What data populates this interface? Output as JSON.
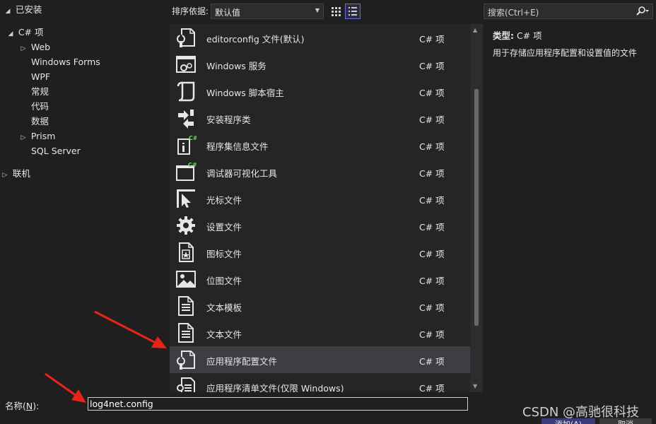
{
  "tree": {
    "installed": "已安装",
    "csharp": "C# 项",
    "children": [
      "Web",
      "Windows Forms",
      "WPF",
      "常规",
      "代码",
      "数据",
      "Prism",
      "SQL Server"
    ],
    "online": "联机"
  },
  "toolbar": {
    "sort_label": "排序依据:",
    "sort_value": "默认值",
    "search_placeholder": "搜索(Ctrl+E)"
  },
  "items": [
    {
      "name": "editorconfig 文件(默认)",
      "type": "C# 项",
      "icon": "config-file-icon"
    },
    {
      "name": "Windows 服务",
      "type": "C# 项",
      "icon": "windows-service-icon"
    },
    {
      "name": "Windows 脚本宿主",
      "type": "C# 项",
      "icon": "script-host-icon"
    },
    {
      "name": "安装程序类",
      "type": "C# 项",
      "icon": "installer-class-icon"
    },
    {
      "name": "程序集信息文件",
      "type": "C# 项",
      "icon": "assembly-info-icon"
    },
    {
      "name": "调试器可视化工具",
      "type": "C# 项",
      "icon": "debugger-visualizer-icon"
    },
    {
      "name": "光标文件",
      "type": "C# 项",
      "icon": "cursor-file-icon"
    },
    {
      "name": "设置文件",
      "type": "C# 项",
      "icon": "settings-gear-icon"
    },
    {
      "name": "图标文件",
      "type": "C# 项",
      "icon": "icon-file-icon"
    },
    {
      "name": "位图文件",
      "type": "C# 项",
      "icon": "bitmap-file-icon"
    },
    {
      "name": "文本模板",
      "type": "C# 项",
      "icon": "text-template-icon"
    },
    {
      "name": "文本文件",
      "type": "C# 项",
      "icon": "text-file-icon"
    },
    {
      "name": "应用程序配置文件",
      "type": "C# 项",
      "icon": "app-config-icon",
      "selected": true
    },
    {
      "name": "应用程序清单文件(仅限 Windows)",
      "type": "C# 项",
      "icon": "manifest-file-icon"
    }
  ],
  "details": {
    "type_label": "类型:",
    "type_value": "C# 项",
    "description": "用于存储应用程序配置和设置值的文件"
  },
  "bottom": {
    "name_label_prefix": "名称(",
    "name_label_key": "N",
    "name_label_suffix": "):",
    "name_value": "log4net.config",
    "watermark": "CSDN @高驰很科技",
    "add_button": "添加(A)",
    "cancel_button": "取消"
  },
  "colors": {
    "background": "#1f1f1f",
    "list_background": "#252526",
    "selected_row": "#3e3e42",
    "accent": "#6b6bd6",
    "annotation_arrow": "#e8241a"
  }
}
